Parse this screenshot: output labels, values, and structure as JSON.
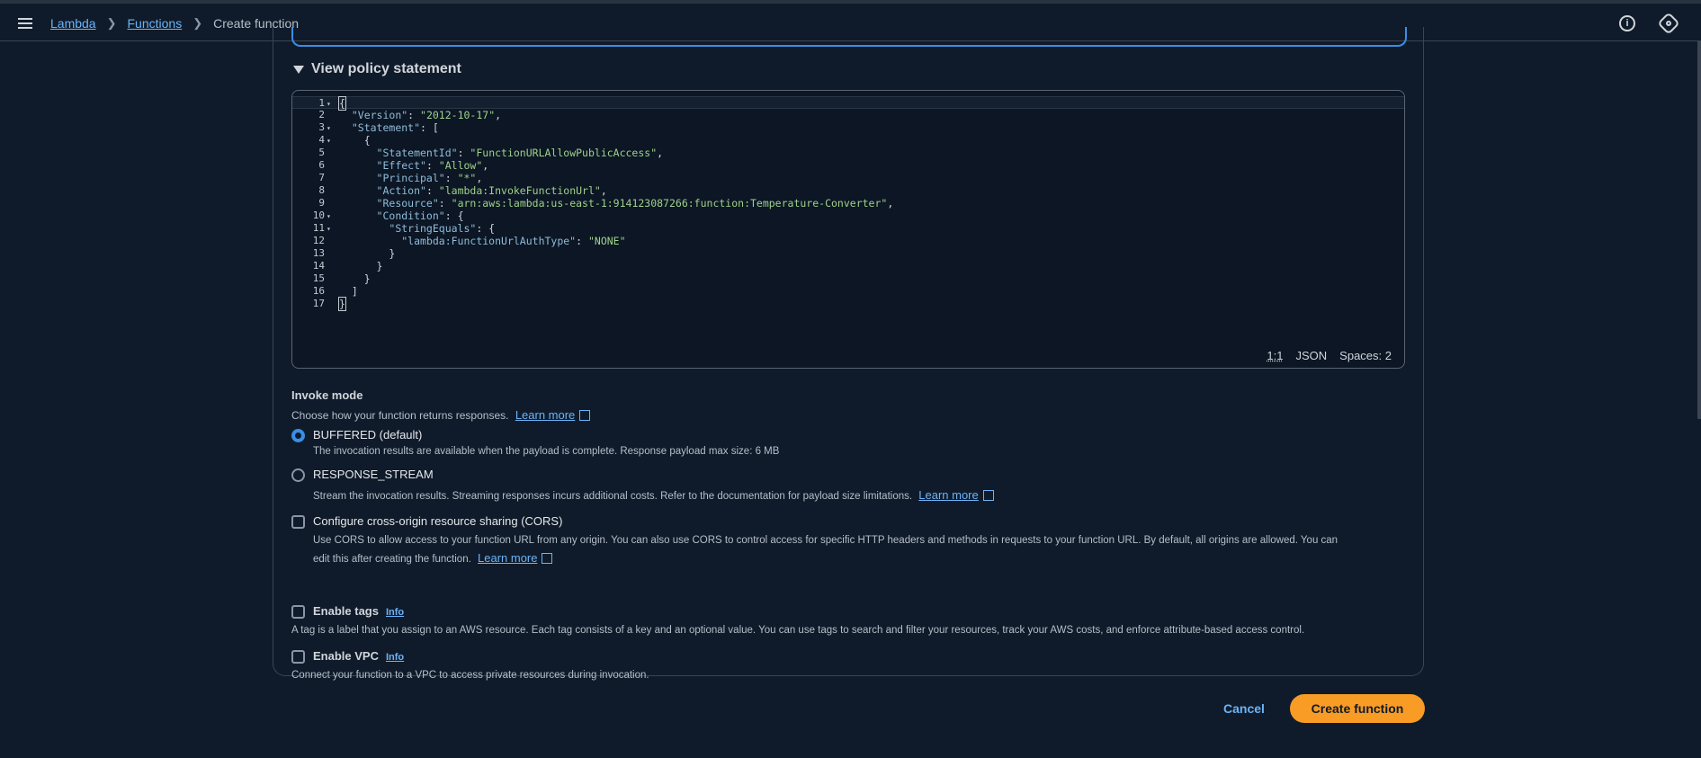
{
  "breadcrumb": {
    "items": [
      "Lambda",
      "Functions"
    ],
    "current": "Create function"
  },
  "policy": {
    "toggle_label": "View policy statement",
    "code": [
      [
        {
          "t": "{",
          "c": "p"
        }
      ],
      [
        {
          "t": "  ",
          "c": "p"
        },
        {
          "t": "\"Version\"",
          "c": "k"
        },
        {
          "t": ": ",
          "c": "p"
        },
        {
          "t": "\"2012-10-17\"",
          "c": "s"
        },
        {
          "t": ",",
          "c": "p"
        }
      ],
      [
        {
          "t": "  ",
          "c": "p"
        },
        {
          "t": "\"Statement\"",
          "c": "k"
        },
        {
          "t": ": [",
          "c": "p"
        }
      ],
      [
        {
          "t": "    {",
          "c": "p"
        }
      ],
      [
        {
          "t": "      ",
          "c": "p"
        },
        {
          "t": "\"StatementId\"",
          "c": "k"
        },
        {
          "t": ": ",
          "c": "p"
        },
        {
          "t": "\"FunctionURLAllowPublicAccess\"",
          "c": "s"
        },
        {
          "t": ",",
          "c": "p"
        }
      ],
      [
        {
          "t": "      ",
          "c": "p"
        },
        {
          "t": "\"Effect\"",
          "c": "k"
        },
        {
          "t": ": ",
          "c": "p"
        },
        {
          "t": "\"Allow\"",
          "c": "s"
        },
        {
          "t": ",",
          "c": "p"
        }
      ],
      [
        {
          "t": "      ",
          "c": "p"
        },
        {
          "t": "\"Principal\"",
          "c": "k"
        },
        {
          "t": ": ",
          "c": "p"
        },
        {
          "t": "\"*\"",
          "c": "s"
        },
        {
          "t": ",",
          "c": "p"
        }
      ],
      [
        {
          "t": "      ",
          "c": "p"
        },
        {
          "t": "\"Action\"",
          "c": "k"
        },
        {
          "t": ": ",
          "c": "p"
        },
        {
          "t": "\"lambda:InvokeFunctionUrl\"",
          "c": "s"
        },
        {
          "t": ",",
          "c": "p"
        }
      ],
      [
        {
          "t": "      ",
          "c": "p"
        },
        {
          "t": "\"Resource\"",
          "c": "k"
        },
        {
          "t": ": ",
          "c": "p"
        },
        {
          "t": "\"arn:aws:lambda:us-east-1:914123087266:function:Temperature-Converter\"",
          "c": "s"
        },
        {
          "t": ",",
          "c": "p"
        }
      ],
      [
        {
          "t": "      ",
          "c": "p"
        },
        {
          "t": "\"Condition\"",
          "c": "k"
        },
        {
          "t": ": {",
          "c": "p"
        }
      ],
      [
        {
          "t": "        ",
          "c": "p"
        },
        {
          "t": "\"StringEquals\"",
          "c": "k"
        },
        {
          "t": ": {",
          "c": "p"
        }
      ],
      [
        {
          "t": "          ",
          "c": "p"
        },
        {
          "t": "\"lambda:FunctionUrlAuthType\"",
          "c": "k"
        },
        {
          "t": ": ",
          "c": "p"
        },
        {
          "t": "\"NONE\"",
          "c": "s"
        }
      ],
      [
        {
          "t": "        }",
          "c": "p"
        }
      ],
      [
        {
          "t": "      }",
          "c": "p"
        }
      ],
      [
        {
          "t": "    }",
          "c": "p"
        }
      ],
      [
        {
          "t": "  ]",
          "c": "p"
        }
      ],
      [
        {
          "t": "}",
          "c": "p"
        }
      ]
    ],
    "foldable_lines": [
      1,
      3,
      4,
      10,
      11
    ],
    "status_position": "1:1",
    "status_language": "JSON",
    "status_spaces": "Spaces: 2"
  },
  "invoke_mode": {
    "title": "Invoke mode",
    "description": "Choose how your function returns responses.",
    "learn_more": "Learn more",
    "options": [
      {
        "label": "BUFFERED (default)",
        "description": "The invocation results are available when the payload is complete. Response payload max size: 6 MB",
        "selected": true
      },
      {
        "label": "RESPONSE_STREAM",
        "description": "Stream the invocation results. Streaming responses incurs additional costs. Refer to the documentation for payload size limitations.",
        "learn_more": "Learn more",
        "selected": false
      }
    ]
  },
  "cors": {
    "label": "Configure cross-origin resource sharing (CORS)",
    "description_line1": "Use CORS to allow access to your function URL from any origin. You can also use CORS to control access for specific HTTP headers and methods in requests to your function URL. By default, all origins are allowed. You can",
    "description_line2": "edit this after creating the function.",
    "learn_more": "Learn more",
    "checked": false
  },
  "tags": {
    "label": "Enable tags",
    "info": "Info",
    "description": "A tag is a label that you assign to an AWS resource. Each tag consists of a key and an optional value. You can use tags to search and filter your resources, track your AWS costs, and enforce attribute-based access control.",
    "checked": false
  },
  "vpc": {
    "label": "Enable VPC",
    "info": "Info",
    "description": "Connect your function to a VPC to access private resources during invocation.",
    "checked": false
  },
  "actions": {
    "cancel": "Cancel",
    "create": "Create function"
  },
  "colors": {
    "accent": "#f89c26",
    "link": "#6cb3f7",
    "selected_radio": "#3a8ee6",
    "background": "#0f1b2a"
  }
}
